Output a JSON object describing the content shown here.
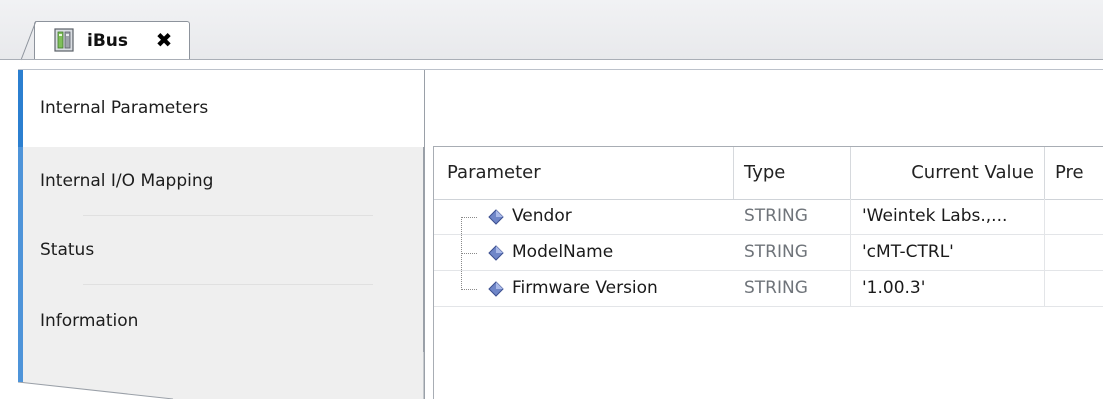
{
  "document_tab": {
    "title": "iBus",
    "close_glyph": "✖",
    "icon": "device-module-icon"
  },
  "side_tabs": [
    {
      "label": "Internal Parameters",
      "active": true
    },
    {
      "label": "Internal I/O Mapping",
      "active": false
    },
    {
      "label": "Status",
      "active": false
    },
    {
      "label": "Information",
      "active": false
    }
  ],
  "table": {
    "columns": [
      "Parameter",
      "Type",
      "Current Value",
      "Pre"
    ],
    "rows": [
      {
        "parameter": "Vendor",
        "type": "STRING",
        "current_value": "'Weintek Labs.,..."
      },
      {
        "parameter": "ModelName",
        "type": "STRING",
        "current_value": "'cMT-CTRL'"
      },
      {
        "parameter": "Firmware Version",
        "type": "STRING",
        "current_value": "'1.00.3'"
      }
    ]
  },
  "colors": {
    "accent": "#2b7fd0",
    "tab_inactive_bg": "#efefef",
    "type_text": "#6f747a"
  }
}
